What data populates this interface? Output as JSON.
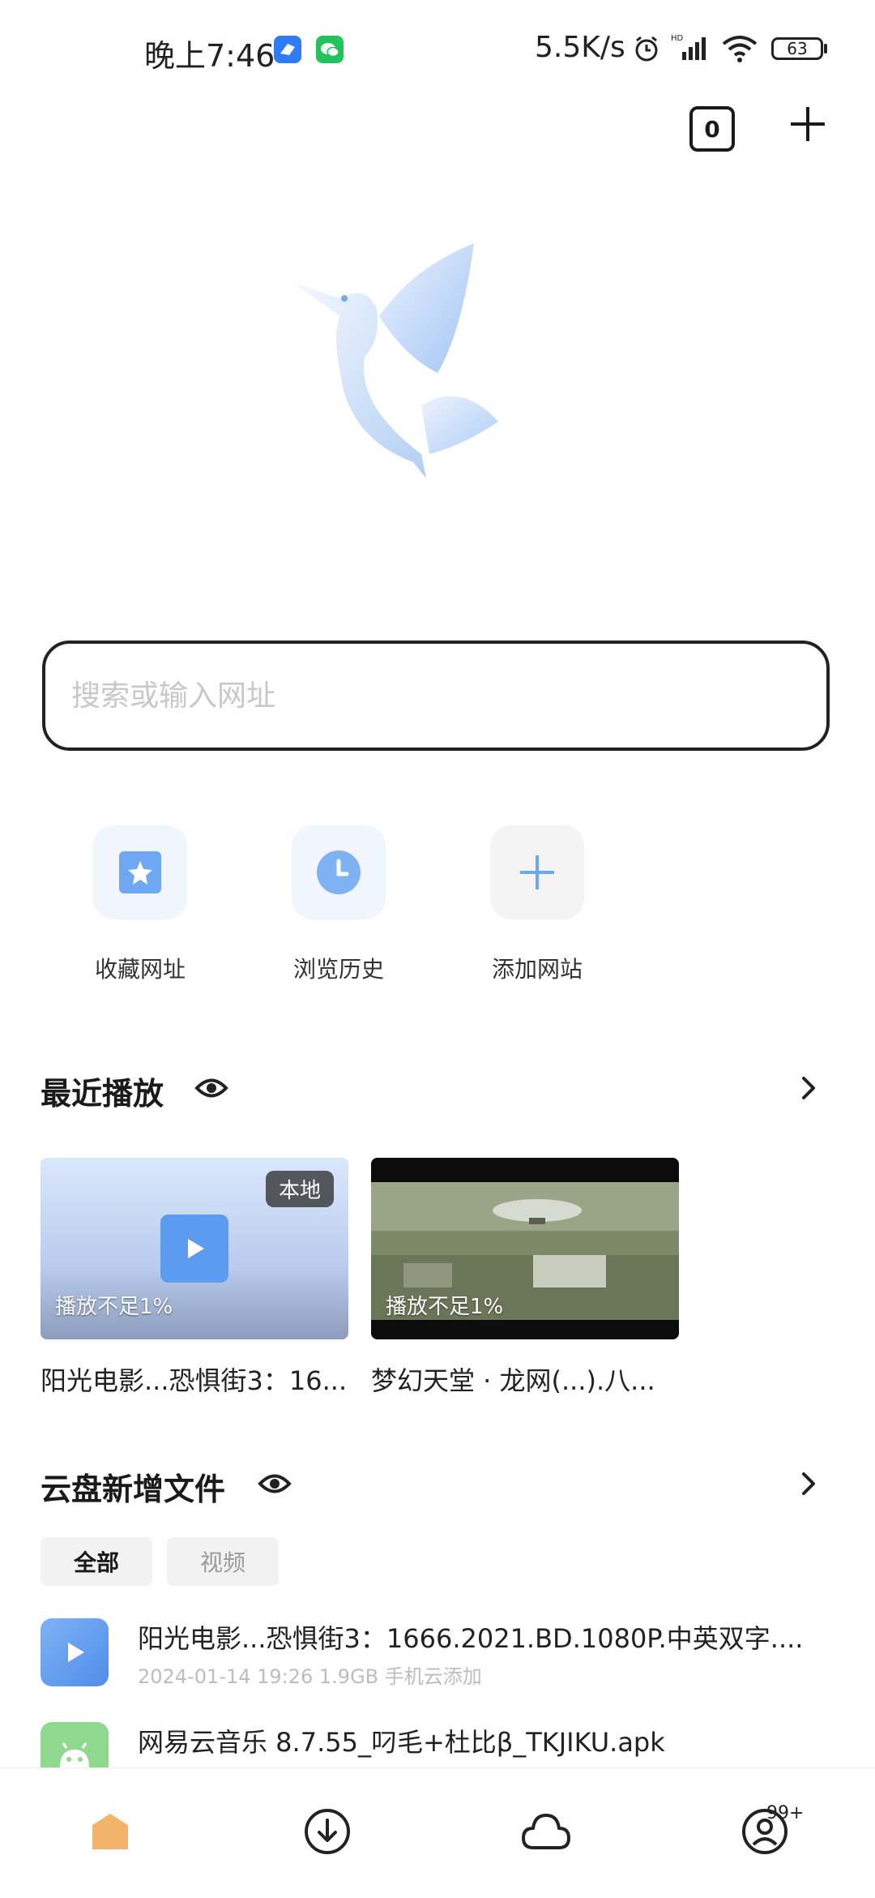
{
  "status_bar": {
    "time": "晚上7:46",
    "network_speed": "5.5K/s",
    "battery": "63"
  },
  "header": {
    "tab_count": "0"
  },
  "search": {
    "placeholder": "搜索或输入网址"
  },
  "shortcuts": [
    {
      "label": "收藏网址",
      "icon": "bookmark-star-icon"
    },
    {
      "label": "浏览历史",
      "icon": "history-clock-icon"
    },
    {
      "label": "添加网站",
      "icon": "plus-icon"
    }
  ],
  "recent": {
    "title": "最近播放",
    "cards": [
      {
        "title": "阳光电影...恐惧街3：16...",
        "progress": "播放不足1%",
        "badge": "本地"
      },
      {
        "title": "梦幻天堂 · 龙网(...).八...",
        "progress": "播放不足1%"
      }
    ]
  },
  "cloud": {
    "title": "云盘新增文件",
    "filters": [
      "全部",
      "视频"
    ],
    "active_filter": "全部",
    "files": [
      {
        "name": "阳光电影...恐惧街3：1666.2021.BD.1080P.中英双字....",
        "meta": "2024-01-14 19:26  1.9GB  手机云添加",
        "type": "video"
      },
      {
        "name": "网易云音乐 8.7.55_叼毛+杜比β_TKJIKU.apk",
        "meta": "",
        "type": "apk"
      }
    ]
  },
  "bottom_nav": {
    "items": [
      "home-icon",
      "download-icon",
      "cloud-icon",
      "profile-icon"
    ],
    "profile_badge": "99+"
  },
  "colors": {
    "accent_blue": "#5b9bf0",
    "home_orange": "#f2b36a",
    "apk_green": "#8fd98f"
  }
}
